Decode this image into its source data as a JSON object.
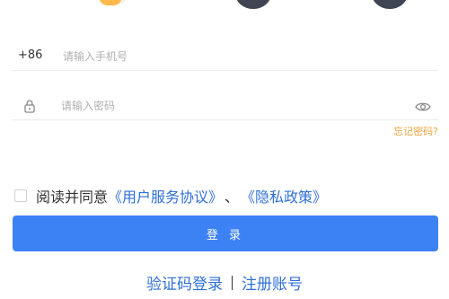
{
  "top_icons": [
    "app-icon",
    "social-login-icon",
    "social-login-icon"
  ],
  "phone": {
    "prefix": "+86",
    "placeholder": "请输入手机号",
    "value": ""
  },
  "password": {
    "placeholder": "请输入密码",
    "value": ""
  },
  "forgot_password": "忘记密码?",
  "agreement": {
    "checked": false,
    "text": "阅读并同意",
    "user_agreement": "《用户服务协议》",
    "separator": "、",
    "privacy_policy": "《隐私政策》"
  },
  "login_button": "登 录",
  "bottom": {
    "sms_login": "验证码登录",
    "register": "注册账号"
  },
  "colors": {
    "primary": "#3d82f5",
    "link": "#2f6fd6",
    "warning": "#f0a33c"
  }
}
